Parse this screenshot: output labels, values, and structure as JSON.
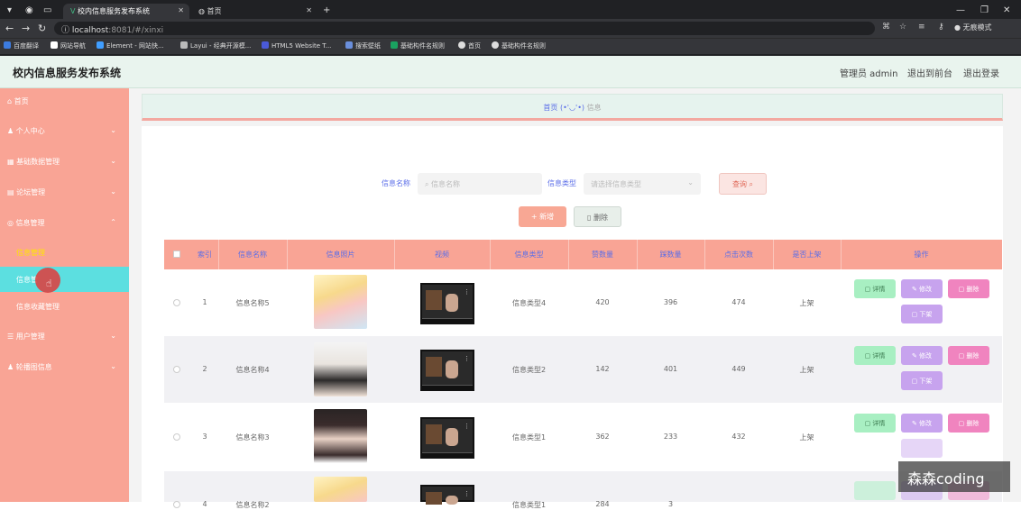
{
  "browser": {
    "tabs": [
      {
        "title": "校内信息服务发布系统",
        "active": true
      },
      {
        "title": "首页",
        "active": false
      }
    ],
    "url_host": "localhost",
    "url_rest": ":8081/#/xinxi",
    "profile_label": "无痕模式",
    "bookmarks": [
      "百度翻译",
      "网站导航",
      "Element - 网站快...",
      "Layui - 经典开源模...",
      "HTML5 Website T...",
      "搜索壁纸",
      "基础构件名规则",
      "首页",
      "基础构件名规则"
    ]
  },
  "header": {
    "title": "校内信息服务发布系统",
    "links": [
      "管理员 admin",
      "退出到前台",
      "退出登录"
    ]
  },
  "sidebar": {
    "items": [
      {
        "label": "首页",
        "icon": "home-icon",
        "chevron": false
      },
      {
        "label": "个人中心",
        "icon": "user-icon",
        "chevron": true
      },
      {
        "label": "基础数据管理",
        "icon": "grid-icon",
        "chevron": true
      },
      {
        "label": "论坛管理",
        "icon": "forum-icon",
        "chevron": true
      },
      {
        "label": "信息管理",
        "icon": "info-icon",
        "chevron": true
      },
      {
        "label": "信息管理",
        "sub": true
      },
      {
        "label": "信息管",
        "sub": true,
        "active": true
      },
      {
        "label": "信息收藏管理",
        "sub": true
      },
      {
        "label": "用户管理",
        "icon": "users-icon",
        "chevron": true
      },
      {
        "label": "轮播图信息",
        "icon": "image-icon",
        "chevron": true
      }
    ]
  },
  "breadcrumb": {
    "home": "首页",
    "face": "(•'◡'•)",
    "current": "信息"
  },
  "filters": {
    "name_label": "信息名称",
    "name_placeholder": "信息名称",
    "type_label": "信息类型",
    "type_placeholder": "请选择信息类型",
    "query_label": "查询"
  },
  "actions": {
    "add_label": "新增",
    "delete_label": "删除"
  },
  "table": {
    "columns": [
      "索引",
      "信息名称",
      "信息照片",
      "视频",
      "信息类型",
      "赞数量",
      "踩数量",
      "点击次数",
      "是否上架",
      "操作"
    ],
    "rows": [
      {
        "index": "1",
        "name": "信息名称5",
        "type": "信息类型4",
        "likes": "420",
        "dislikes": "396",
        "clicks": "474",
        "status": "上架"
      },
      {
        "index": "2",
        "name": "信息名称4",
        "type": "信息类型2",
        "likes": "142",
        "dislikes": "401",
        "clicks": "449",
        "status": "上架"
      },
      {
        "index": "3",
        "name": "信息名称3",
        "type": "信息类型1",
        "likes": "362",
        "dislikes": "233",
        "clicks": "432",
        "status": "上架"
      },
      {
        "index": "4",
        "name": "信息名称2",
        "type": "信息类型1",
        "likes": "284",
        "dislikes": "3",
        "clicks": "",
        "status": ""
      }
    ],
    "row_actions": {
      "view": "详情",
      "edit": "修改",
      "delete": "删除",
      "down": "下架"
    }
  },
  "watermark": "森森coding",
  "colors": {
    "sidebar": "#f9a495",
    "active_item": "#5cdfe0",
    "accent_text": "#5b6ee8",
    "topbar": "#e9f4ee"
  }
}
